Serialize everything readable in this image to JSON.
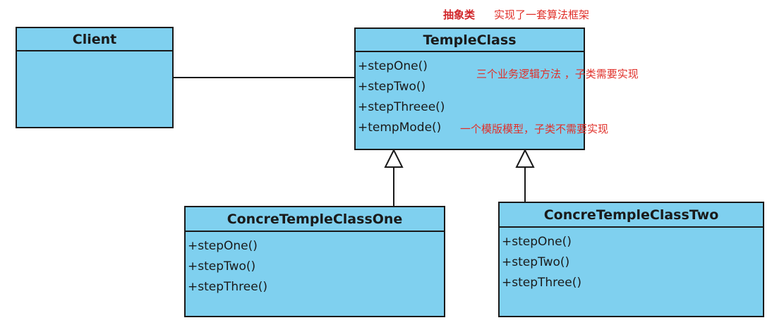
{
  "annotations": {
    "abstract_label": "抽象类",
    "framework_note": "实现了一套算法框架",
    "business_methods_note": "三个业务逻辑方法 ，子类需要实现",
    "template_method_note": "一个模版模型，子类不需要实现"
  },
  "classes": {
    "client": {
      "name": "Client",
      "methods": []
    },
    "temple_class": {
      "name": "TempleClass",
      "methods": [
        "+stepOne()",
        "+stepTwo()",
        "+stepThreee()",
        "+tempMode()"
      ]
    },
    "concrete_one": {
      "name": "ConcreTempleClassOne",
      "methods": [
        "+stepOne()",
        "+stepTwo()",
        "+stepThree()"
      ]
    },
    "concrete_two": {
      "name": "ConcreTempleClassTwo",
      "methods": [
        "+stepOne()",
        "+stepTwo()",
        "+stepThree()"
      ]
    }
  },
  "relationships": [
    {
      "type": "association",
      "from": "Client",
      "to": "TempleClass"
    },
    {
      "type": "generalization",
      "from": "ConcreTempleClassOne",
      "to": "TempleClass"
    },
    {
      "type": "generalization",
      "from": "ConcreTempleClassTwo",
      "to": "TempleClass"
    }
  ],
  "colors": {
    "class_fill": "#7fd0ef",
    "class_border": "#1a1a1a",
    "annotation_text": "#e0302a"
  }
}
